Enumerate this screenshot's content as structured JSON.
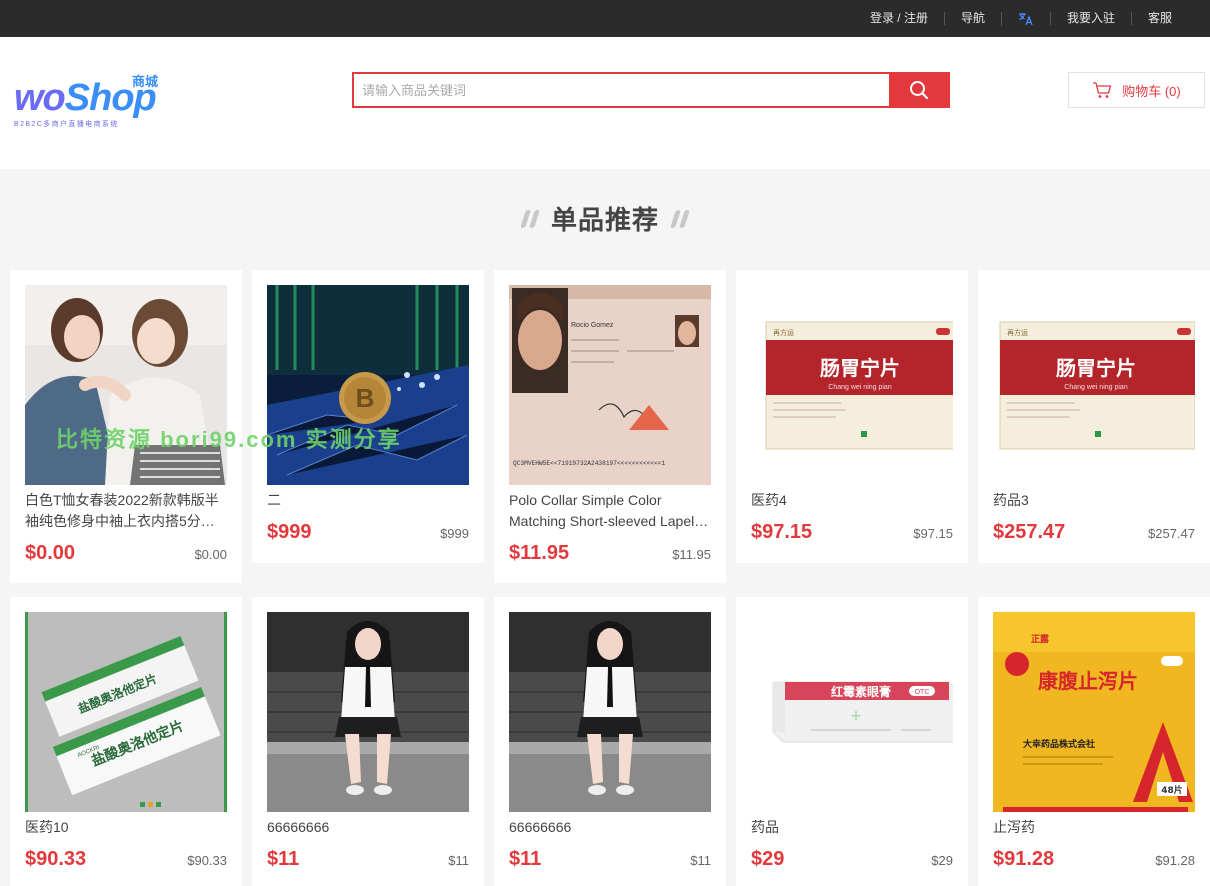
{
  "topbar": {
    "login": "登录 / 注册",
    "nav": "导航",
    "translate_icon": "translate-icon",
    "join": "我要入驻",
    "service": "客服"
  },
  "logo": {
    "text_a": "wo",
    "text_b": "Shop",
    "cn": "商城",
    "sub": "B2B2C多商户直播电商系统"
  },
  "search": {
    "placeholder": "请输入商品关键词",
    "icon": "search-icon"
  },
  "cart": {
    "label": "购物车 (0)",
    "icon": "cart-icon"
  },
  "section": {
    "title": "单品推荐"
  },
  "watermark": "比特资源 bori99.com 实测分享",
  "colors": {
    "accent": "#e4393c",
    "topbar": "#2b2b2b",
    "logo": "#6a6cf5"
  },
  "products": [
    {
      "name": "白色T恤女春装2022新款韩版半袖纯色修身中袖上衣内搭5分…",
      "price": "$0.00",
      "oprice": "$0.00",
      "img": "women-photo"
    },
    {
      "name": "二",
      "price": "$999",
      "oprice": "$999",
      "img": "bitcoin-circuit-photo"
    },
    {
      "name": "Polo Collar Simple Color Matching Short-sleeved Lapel…",
      "price": "$11.95",
      "oprice": "$11.95",
      "img": "id-document-photo"
    },
    {
      "name": "医药4",
      "price": "$97.15",
      "oprice": "$97.15",
      "img": "medicine-box-red"
    },
    {
      "name": "药品3",
      "price": "$257.47",
      "oprice": "$257.47",
      "img": "medicine-box-red"
    },
    {
      "name": "医药10",
      "price": "$90.33",
      "oprice": "$90.33",
      "img": "medicine-box-green"
    },
    {
      "name": "66666666",
      "price": "$11",
      "oprice": "$11",
      "img": "girl-sitting-photo"
    },
    {
      "name": "66666666",
      "price": "$11",
      "oprice": "$11",
      "img": "girl-sitting-photo"
    },
    {
      "name": "药品",
      "price": "$29",
      "oprice": "$29",
      "img": "ointment-box"
    },
    {
      "name": "止泻药",
      "price": "$91.28",
      "oprice": "$91.28",
      "img": "medicine-box-yellow"
    }
  ],
  "box_labels": {
    "red_title": "肠胃宁片",
    "red_pinyin": "Chang wei ning pian",
    "red_brand": "再方运",
    "green_title": "盐酸奥洛他定片",
    "green_brand": "AOCKRI",
    "oint_title": "红霉素眼膏",
    "oint_otc": "OTC",
    "yellow_brand": "正露",
    "yellow_title": "康腹止泻片",
    "yellow_company": "大幸药品株式会社",
    "yellow_count": "48片",
    "id_name": "Rocio Gomez",
    "id_mrz": "QC3MVEHW5E<<71919732A2438197<<<<<<<<<<<<1"
  }
}
